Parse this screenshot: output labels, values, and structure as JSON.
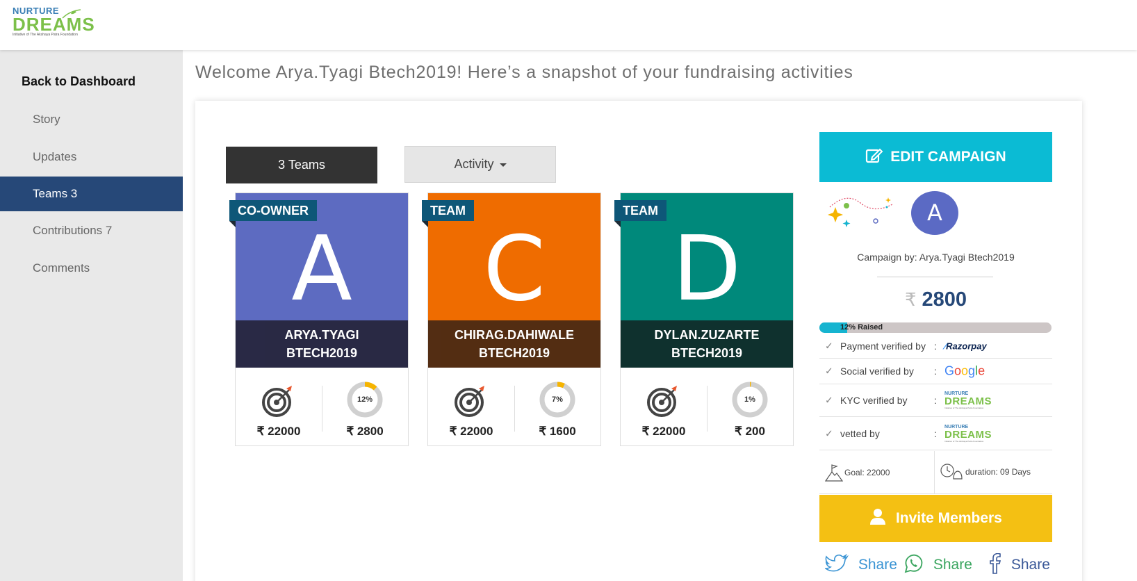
{
  "header": {
    "logo_line1": "NURTURE",
    "logo_line2": "DREAMS",
    "logo_line3": "Initiative of The Akshaya Patra Foundation"
  },
  "sidebar": {
    "back_label": "Back to Dashboard",
    "items": [
      {
        "label": "Story"
      },
      {
        "label": "Updates"
      },
      {
        "label": "Teams 3",
        "active": true
      },
      {
        "label": "Contributions 7"
      },
      {
        "label": "Comments"
      }
    ]
  },
  "main": {
    "welcome": "Welcome Arya.Tyagi Btech2019! Here’s a snapshot of your fundraising activities",
    "teams_button": "3  Teams",
    "activity_button": "Activity"
  },
  "cards": [
    {
      "role": "CO-OWNER",
      "letter": "A",
      "name1": "ARYA.TYAGI",
      "name2": "BTECH2019",
      "color": "#5d6bc1",
      "bar_color": "#1e1e3b",
      "goal": "₹ 22000",
      "percent_label": "12%",
      "percent": 12,
      "raised": "₹ 2800"
    },
    {
      "role": "TEAM",
      "letter": "C",
      "name1": "CHIRAG.DAHIWALE",
      "name2": "BTECH2019",
      "color": "#ef6c00",
      "bar_color": "#4a2206",
      "goal": "₹ 22000",
      "percent_label": "7%",
      "percent": 7,
      "raised": "₹ 1600"
    },
    {
      "role": "TEAM",
      "letter": "D",
      "name1": "DYLAN.ZUZARTE",
      "name2": "BTECH2019",
      "color": "#00897b",
      "bar_color": "#032723",
      "goal": "₹ 22000",
      "percent_label": "1%",
      "percent": 1,
      "raised": "₹ 200"
    }
  ],
  "right": {
    "edit_button": "EDIT CAMPAIGN",
    "avatar_letter": "A",
    "campaign_by": "Campaign by: Arya.Tyagi Btech2019",
    "currency_symbol": "₹",
    "raised_amount": "2800",
    "progress_label": "12% Raised",
    "progress_percent": 12,
    "verifications": [
      {
        "label": "Payment verified by",
        "colon": ":",
        "provider": "Razorpay"
      },
      {
        "label": "Social verified by",
        "colon": ":",
        "provider": "Google"
      },
      {
        "label": "KYC verified by",
        "colon": ":",
        "provider": "Nurture Dreams"
      },
      {
        "label": "vetted by",
        "colon": ":",
        "provider": "Nurture Dreams"
      }
    ],
    "goal": "Goal: 22000",
    "duration": "duration: 09 Days",
    "invite_button": "Invite Members",
    "share_twitter": "Share",
    "share_whatsapp": "Share",
    "share_facebook": "Share"
  },
  "colors": {
    "sidebar_active": "#264878",
    "edit_button": "#0bbbd4",
    "invite_button": "#f4c013",
    "ribbon": "#0e5778",
    "donut_fill": "#f6b400"
  }
}
